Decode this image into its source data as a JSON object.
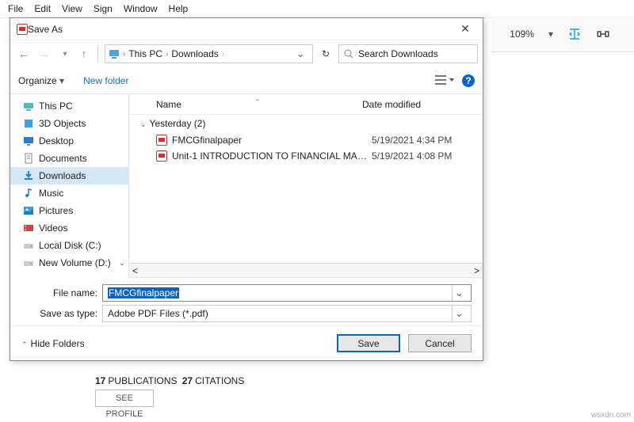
{
  "menubar": [
    "File",
    "Edit",
    "View",
    "Sign",
    "Window",
    "Help"
  ],
  "toolbar": {
    "zoom": "109%"
  },
  "dialog": {
    "title": "Save As",
    "path": {
      "root": "This PC",
      "folder": "Downloads"
    },
    "search_placeholder": "Search Downloads",
    "organize": "Organize",
    "organize_caret": "▾",
    "newfolder": "New folder",
    "tree": [
      {
        "label": "This PC",
        "icon": "pc"
      },
      {
        "label": "3D Objects",
        "icon": "3d"
      },
      {
        "label": "Desktop",
        "icon": "desktop"
      },
      {
        "label": "Documents",
        "icon": "docs"
      },
      {
        "label": "Downloads",
        "icon": "downloads",
        "selected": true
      },
      {
        "label": "Music",
        "icon": "music"
      },
      {
        "label": "Pictures",
        "icon": "pictures"
      },
      {
        "label": "Videos",
        "icon": "videos"
      },
      {
        "label": "Local Disk (C:)",
        "icon": "disk"
      },
      {
        "label": "New Volume (D:)",
        "icon": "disk",
        "expander": true
      }
    ],
    "columns": {
      "name": "Name",
      "date": "Date modified"
    },
    "group": "Yesterday (2)",
    "files": [
      {
        "name": "FMCGfinalpaper",
        "date": "5/19/2021 4:34 PM"
      },
      {
        "name": "Unit-1 INTRODUCTION TO FINANCIAL MANAG...",
        "date": "5/19/2021 4:08 PM"
      }
    ],
    "filename_label": "File name:",
    "filename_value": "FMCGfinalpaper",
    "type_label": "Save as type:",
    "type_value": "Adobe PDF Files (*.pdf)",
    "hide_folders": "Hide Folders",
    "save": "Save",
    "cancel": "Cancel"
  },
  "background": {
    "pubs_label": "PUBLICATIONS",
    "pubs": "17",
    "cits_label": "CITATIONS",
    "cits": "27",
    "see_profile": "SEE PROFILE"
  },
  "watermark": "wsxdn.com"
}
